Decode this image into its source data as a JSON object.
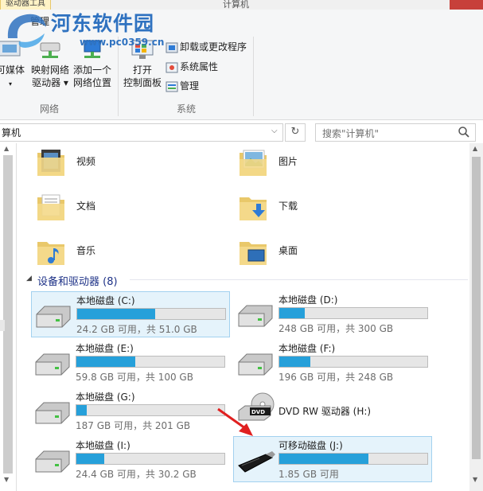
{
  "window": {
    "context_tab": "驱动器工具",
    "title": "计算机",
    "manage_tab": "管理"
  },
  "watermark": {
    "site_name": "河东软件园",
    "url": "www.pc0359.cn"
  },
  "ribbon": {
    "network_group": {
      "label": "网络",
      "buttons": [
        {
          "label1": "可媒体",
          "label2": "▾"
        },
        {
          "label1": "映射网络",
          "label2": "驱动器 ▾"
        },
        {
          "label1": "添加一个",
          "label2": "网络位置"
        }
      ]
    },
    "system_group": {
      "label": "系统",
      "open_panel": {
        "label1": "打开",
        "label2": "控制面板"
      },
      "small_buttons": [
        "卸载或更改程序",
        "系统属性",
        "管理"
      ]
    }
  },
  "address_bar": {
    "path": "算机",
    "search_placeholder": "搜索\"计算机\""
  },
  "folders": [
    {
      "name": "视频",
      "icon": "video-folder-icon"
    },
    {
      "name": "图片",
      "icon": "pictures-folder-icon"
    },
    {
      "name": "文档",
      "icon": "documents-folder-icon"
    },
    {
      "name": "下载",
      "icon": "downloads-folder-icon"
    },
    {
      "name": "音乐",
      "icon": "music-folder-icon"
    },
    {
      "name": "桌面",
      "icon": "desktop-folder-icon"
    }
  ],
  "section": {
    "title": "设备和驱动器 (8)"
  },
  "drives": [
    {
      "name": "本地磁盘 (C:)",
      "size": "24.2 GB 可用，共 51.0 GB",
      "used_fraction": 0.525,
      "selected": true
    },
    {
      "name": "本地磁盘 (D:)",
      "size": "248 GB 可用，共 300 GB",
      "used_fraction": 0.17,
      "selected": false
    },
    {
      "name": "本地磁盘 (E:)",
      "size": "59.8 GB 可用，共 100 GB",
      "used_fraction": 0.4,
      "selected": false
    },
    {
      "name": "本地磁盘 (F:)",
      "size": "196 GB 可用，共 248 GB",
      "used_fraction": 0.21,
      "selected": false
    },
    {
      "name": "本地磁盘 (G:)",
      "size": "187 GB 可用，共 201 GB",
      "used_fraction": 0.07,
      "selected": false
    },
    {
      "name": "DVD RW 驱动器 (H:)",
      "selected": false
    },
    {
      "name": "本地磁盘 (I:)",
      "size": "24.4 GB 可用，共 30.2 GB",
      "used_fraction": 0.19,
      "selected": false
    },
    {
      "name": "可移动磁盘 (J:)",
      "size": "1.85 GB 可用",
      "used_fraction": 0.6,
      "selected": true
    }
  ],
  "colors": {
    "bar_fill": "#26a0da",
    "selection_bg": "#e5f3fb",
    "selection_border": "#a3d1ef",
    "watermark": "#2f72c0",
    "annotation_arrow": "#e02020"
  }
}
